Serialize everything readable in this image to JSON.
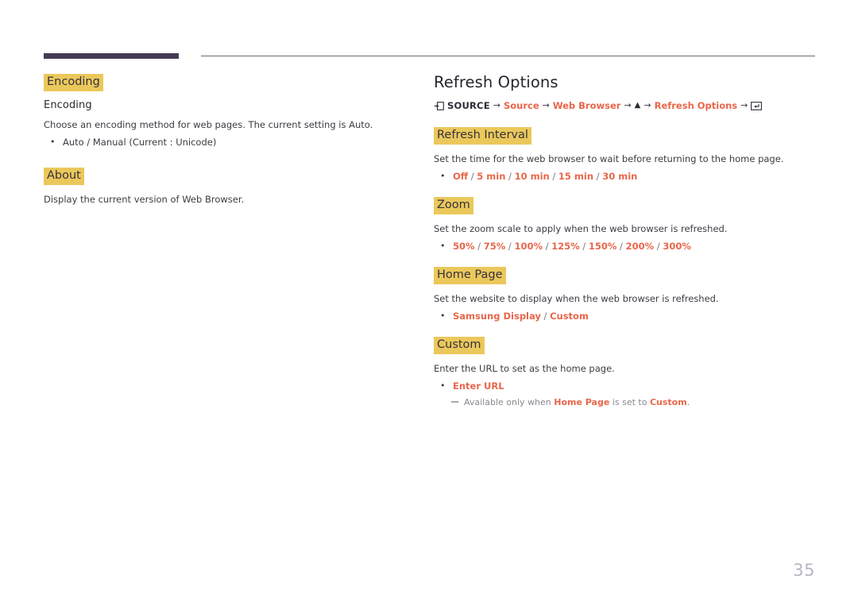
{
  "document": {
    "page_number": "35",
    "accent_color": "#e8664a",
    "highlight_color": "#ebc85b",
    "rule_color": "#443b53"
  },
  "left_column": {
    "sections": [
      {
        "heading": "Encoding",
        "subheading": "Encoding",
        "description": "Choose an encoding method for web pages. The current setting is Auto.",
        "options": [
          {
            "text": "Auto / Manual (Current : Unicode)",
            "style": "plain"
          }
        ]
      },
      {
        "heading": "About",
        "subheading": "",
        "description": "Display the current version of Web Browser.",
        "options": []
      }
    ]
  },
  "right_column": {
    "title": "Refresh Options",
    "breadcrumb": {
      "source_icon": "source-input-icon",
      "source_label": "SOURCE",
      "arrow": "→",
      "items": [
        {
          "label": "Source",
          "type": "link"
        },
        {
          "label": "Web Browser",
          "type": "link"
        },
        {
          "label": "▲",
          "type": "up-arrow-icon"
        },
        {
          "label": "Refresh Options",
          "type": "link"
        }
      ],
      "enter_icon": "enter-key-icon"
    },
    "sections": [
      {
        "heading": "Refresh Interval",
        "description": "Set the time for the web browser to wait before returning to the home page.",
        "option_values": [
          "Off",
          "5 min",
          "10 min",
          "15 min",
          "30 min"
        ],
        "note": null
      },
      {
        "heading": "Zoom",
        "description": "Set the zoom scale to apply when the web browser is refreshed.",
        "option_values": [
          "50%",
          "75%",
          "100%",
          "125%",
          "150%",
          "200%",
          "300%"
        ],
        "note": null
      },
      {
        "heading": "Home Page",
        "description": "Set the website to display when the web browser is refreshed.",
        "option_values": [
          "Samsung Display",
          "Custom"
        ],
        "note": null
      },
      {
        "heading": "Custom",
        "description": "Enter the URL to set as the home page.",
        "option_values": [
          "Enter URL"
        ],
        "note": {
          "prefix": "Available only when ",
          "bold1": "Home Page",
          "middle": " is set to ",
          "bold2": "Custom",
          "suffix": "."
        }
      }
    ]
  }
}
